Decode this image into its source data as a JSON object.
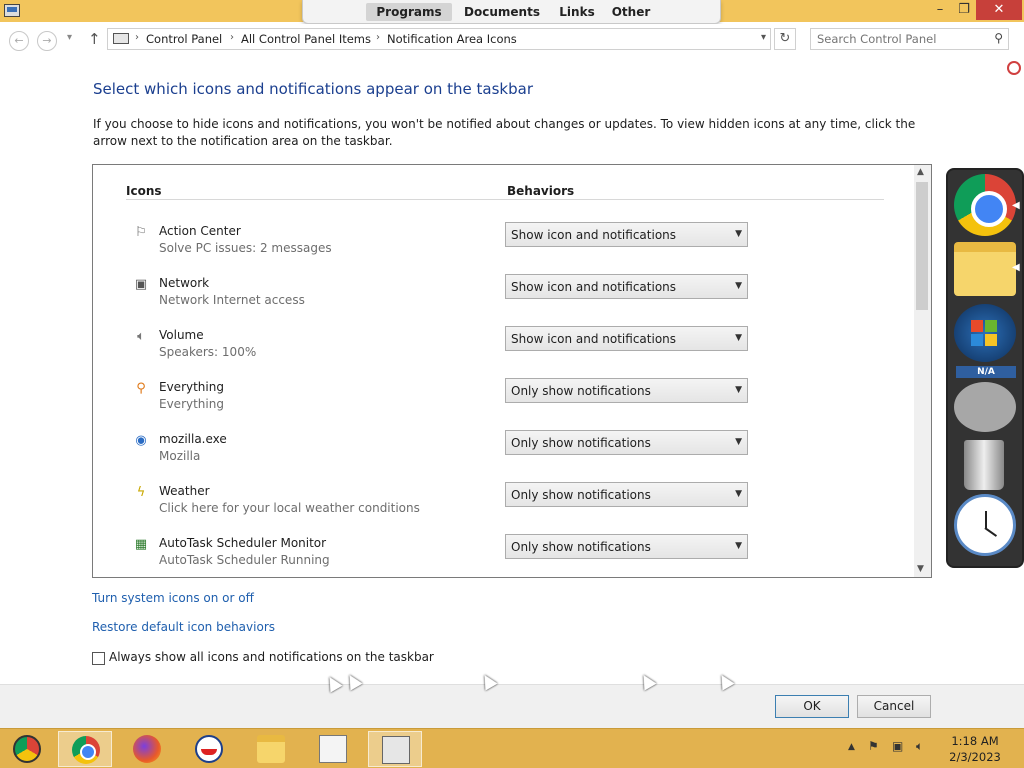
{
  "launcher": {
    "tabs": [
      "Programs",
      "Documents",
      "Links",
      "Other"
    ],
    "active_tab": "Programs"
  },
  "window": {
    "minimize": "–",
    "maximize": "❐",
    "close": "✕"
  },
  "nav": {
    "breadcrumb": [
      "Control Panel",
      "All Control Panel Items",
      "Notification Area Icons"
    ],
    "search_placeholder": "Search Control Panel"
  },
  "content": {
    "heading": "Select which icons and notifications appear on the taskbar",
    "description": "If you choose to hide icons and notifications, you won't be notified about changes or updates. To view hidden icons at any time, click the arrow next to the notification area on the taskbar.",
    "col_icons": "Icons",
    "col_behaviors": "Behaviors",
    "rows": [
      {
        "name": "Action Center",
        "sub": "Solve PC issues: 2 messages",
        "behavior": "Show icon and notifications",
        "icon": "flag-icon"
      },
      {
        "name": "Network",
        "sub": "Network Internet access",
        "behavior": "Show icon and notifications",
        "icon": "network-icon"
      },
      {
        "name": "Volume",
        "sub": "Speakers: 100%",
        "behavior": "Show icon and notifications",
        "icon": "speaker-icon"
      },
      {
        "name": "Everything",
        "sub": "Everything",
        "behavior": "Only show notifications",
        "icon": "magnifier-icon"
      },
      {
        "name": "mozilla.exe",
        "sub": "Mozilla",
        "behavior": "Only show notifications",
        "icon": "mozilla-icon"
      },
      {
        "name": "Weather",
        "sub": "Click here for your local weather conditions",
        "behavior": "Only show notifications",
        "icon": "lightning-icon"
      },
      {
        "name": "AutoTask Scheduler Monitor",
        "sub": "AutoTask Scheduler Running",
        "behavior": "Only show notifications",
        "icon": "scheduler-icon"
      }
    ],
    "link_system_icons": "Turn system icons on or off",
    "link_restore": "Restore default icon behaviors",
    "always_show_label": "Always show all icons and notifications on the taskbar",
    "always_show_checked": false
  },
  "footer": {
    "ok": "OK",
    "cancel": "Cancel"
  },
  "dock": {
    "na_label": "N/A"
  },
  "taskbar": {
    "time": "1:18 AM",
    "date": "2/3/2023",
    "items": [
      "start-orb-icon",
      "chrome-icon",
      "firefox-icon",
      "obama-icon",
      "file-explorer-icon",
      "task-manager-icon",
      "control-panel-icon"
    ]
  },
  "colors": {
    "heading": "#1b3f8f",
    "link": "#1f5fae",
    "titlebar": "#f2c55c",
    "taskbar": "#e2b24f"
  }
}
